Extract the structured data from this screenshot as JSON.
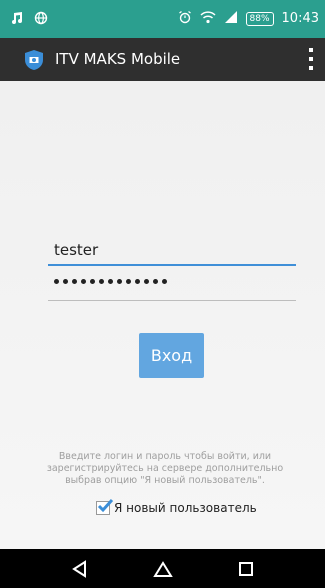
{
  "status_bar": {
    "battery": "88%",
    "time": "10:43"
  },
  "app_bar": {
    "title": "ITV MAKS Mobile",
    "icons": [
      "shield-app-icon",
      "overflow-menu-icon"
    ]
  },
  "login": {
    "username_value": "tester",
    "password_mask": "•••••••••••••",
    "button_label": "Вход"
  },
  "hint_text": "Введите логин и пароль чтобы войти, или зарегистрируйтесь на сервере дополнительно выбрав опцию \"Я новый пользователь\".",
  "new_user": {
    "label": "Я новый пользователь",
    "checked": true
  },
  "colors": {
    "status_bar": "#2b9f8f",
    "app_bar": "#2f2f2f",
    "accent": "#3f8fd8",
    "button": "#62a6e0"
  }
}
